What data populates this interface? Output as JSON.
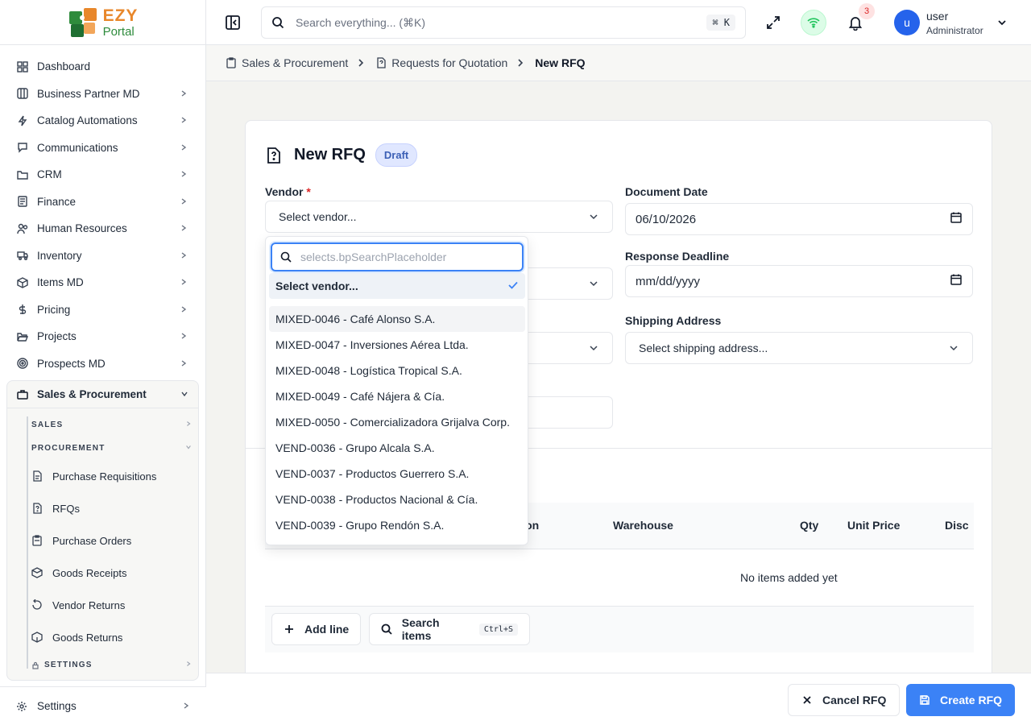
{
  "logo": {
    "brand": "EZY",
    "product": "Portal"
  },
  "sidebar": {
    "items": [
      {
        "label": "Dashboard",
        "icon": "dashboard-icon",
        "chevron": false
      },
      {
        "label": "Business Partner MD",
        "icon": "columns-icon",
        "chevron": true
      },
      {
        "label": "Catalog Automations",
        "icon": "bolt-icon",
        "chevron": true
      },
      {
        "label": "Communications",
        "icon": "chat-icon",
        "chevron": true
      },
      {
        "label": "CRM",
        "icon": "folder-icon",
        "chevron": true
      },
      {
        "label": "Finance",
        "icon": "ledger-icon",
        "chevron": true
      },
      {
        "label": "Human Resources",
        "icon": "users-icon",
        "chevron": true
      },
      {
        "label": "Inventory",
        "icon": "truck-icon",
        "chevron": true
      },
      {
        "label": "Items MD",
        "icon": "box-icon",
        "chevron": true
      },
      {
        "label": "Pricing",
        "icon": "dollar-icon",
        "chevron": true
      },
      {
        "label": "Projects",
        "icon": "folder-open-icon",
        "chevron": true
      },
      {
        "label": "Prospects MD",
        "icon": "target-icon",
        "chevron": true
      }
    ],
    "active_group": {
      "label": "Sales & Procurement",
      "sections": [
        {
          "label": "SALES"
        },
        {
          "label": "PROCUREMENT"
        }
      ],
      "procurement_items": [
        {
          "label": "Purchase Requisitions"
        },
        {
          "label": "RFQs"
        },
        {
          "label": "Purchase Orders"
        },
        {
          "label": "Goods Receipts"
        },
        {
          "label": "Vendor Returns"
        },
        {
          "label": "Goods Returns"
        }
      ],
      "settings_section": "SETTINGS"
    },
    "settings_label": "Settings"
  },
  "header": {
    "search_placeholder": "Search everything... (⌘K)",
    "shortcut": "⌘ K",
    "notification_count": "3",
    "avatar_initial": "u",
    "user_name": "user",
    "user_role": "Administrator"
  },
  "breadcrumb": [
    "Sales & Procurement",
    "Requests for Quotation",
    "New RFQ"
  ],
  "form": {
    "title": "New RFQ",
    "status": "Draft",
    "vendor_label": "Vendor",
    "vendor_required": "*",
    "vendor_value": "Select vendor...",
    "document_date_label": "Document Date",
    "document_date_value": "06/10/2026",
    "response_deadline_label": "Response Deadline",
    "response_deadline_value": "mm/dd/yyyy",
    "shipping_address_label": "Shipping Address",
    "shipping_address_value": "Select shipping address..."
  },
  "lines": {
    "columns": [
      "ption",
      "Warehouse",
      "Qty",
      "Unit Price",
      "Disc"
    ],
    "empty_text": "No items added yet",
    "add_line_label": "Add line",
    "search_items_label": "Search items",
    "search_items_shortcut": "Ctrl+S"
  },
  "vendor_dropdown": {
    "search_placeholder": "selects.bpSearchPlaceholder",
    "options": [
      "Select vendor...",
      "MIXED-0046 - Café Alonso S.A.",
      "MIXED-0047 - Inversiones Aérea Ltda.",
      "MIXED-0048 - Logística Tropical S.A.",
      "MIXED-0049 - Café Nájera & Cía.",
      "MIXED-0050 - Comercializadora Grijalva Corp.",
      "VEND-0036 - Grupo Alcala S.A.",
      "VEND-0037 - Productos Guerrero S.A.",
      "VEND-0038 - Productos Nacional & Cía.",
      "VEND-0039 - Grupo Rendón S.A."
    ],
    "selected_index": 0,
    "hover_index": 1
  },
  "footer": {
    "cancel_label": "Cancel RFQ",
    "create_label": "Create RFQ"
  },
  "colors": {
    "accent": "#3b82f6",
    "draft_badge": "#e0e7ff",
    "notification": "#dc2626",
    "online": "#22c55e"
  }
}
